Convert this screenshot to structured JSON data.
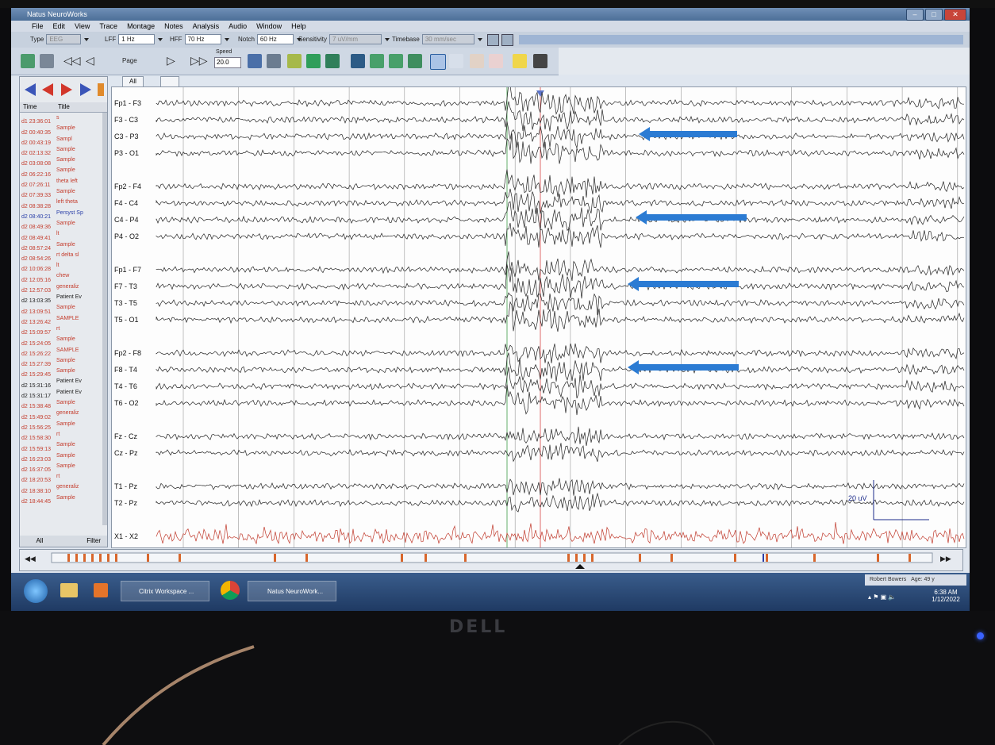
{
  "window": {
    "title": "Natus NeuroWorks"
  },
  "menu": [
    "File",
    "Edit",
    "View",
    "Trace",
    "Montage",
    "Notes",
    "Analysis",
    "Audio",
    "Window",
    "Help"
  ],
  "toolbar": {
    "type": {
      "label": "Type",
      "value": "EEG"
    },
    "lff": {
      "label": "LFF",
      "value": "1 Hz"
    },
    "hff": {
      "label": "HFF",
      "value": "70 Hz"
    },
    "notch": {
      "label": "Notch",
      "value": "60 Hz"
    },
    "sensitivity": {
      "label": "Sensitivity",
      "value": "7 uV/mm"
    },
    "timebase": {
      "label": "Timebase",
      "value": "30 mm/sec"
    },
    "page_label": "Page",
    "speed_label": "Speed",
    "speed_value": "20.0"
  },
  "sidebar": {
    "col_time": "Time",
    "col_title": "Title",
    "filter_label": "All",
    "filter_value": "Filter",
    "events": [
      {
        "time": "d1 23:36:01",
        "title": "s",
        "color": "#c43c2c"
      },
      {
        "time": "d2 00:40:35",
        "title": "Sample",
        "color": "#c43c2c"
      },
      {
        "time": "d2 00:43:19",
        "title": "Sampl",
        "color": "#c43c2c"
      },
      {
        "time": "d2 02:13:32",
        "title": "Sample",
        "color": "#c43c2c"
      },
      {
        "time": "d2 03:08:08",
        "title": "Sample",
        "color": "#c43c2c"
      },
      {
        "time": "d2 06:22:16",
        "title": "Sample",
        "color": "#c43c2c"
      },
      {
        "time": "d2 07:26:11",
        "title": "theta left",
        "color": "#c43c2c"
      },
      {
        "time": "d2 07:39:33",
        "title": "Sample",
        "color": "#c43c2c"
      },
      {
        "time": "d2 08:38:28",
        "title": "left theta",
        "color": "#c43c2c"
      },
      {
        "time": "d2 08:40:21",
        "title": "Persyst Sp",
        "color": "#2a3fa8"
      },
      {
        "time": "d2 08:49:36",
        "title": "Sample",
        "color": "#c43c2c"
      },
      {
        "time": "d2 08:49:41",
        "title": "lt",
        "color": "#c43c2c"
      },
      {
        "time": "d2 08:57:24",
        "title": "Sample",
        "color": "#c43c2c"
      },
      {
        "time": "d2 08:54:26",
        "title": "rt delta sl",
        "color": "#c43c2c"
      },
      {
        "time": "d2 10:06:28",
        "title": "lt",
        "color": "#c43c2c"
      },
      {
        "time": "d2 12:05:16",
        "title": "chew",
        "color": "#c43c2c"
      },
      {
        "time": "d2 12:57:03",
        "title": "generaliz",
        "color": "#c43c2c"
      },
      {
        "time": "d2 13:03:35",
        "title": "Patient Ev",
        "color": "#222222"
      },
      {
        "time": "d2 13:09:51",
        "title": "Sample",
        "color": "#c43c2c"
      },
      {
        "time": "d2 13:26:42",
        "title": "SAMPLE",
        "color": "#c43c2c"
      },
      {
        "time": "d2 15:09:57",
        "title": "rt",
        "color": "#c43c2c"
      },
      {
        "time": "d2 15:24:05",
        "title": "Sample",
        "color": "#c43c2c"
      },
      {
        "time": "d2 15:26:22",
        "title": "SAMPLE",
        "color": "#c43c2c"
      },
      {
        "time": "d2 15:27:39",
        "title": "Sample",
        "color": "#c43c2c"
      },
      {
        "time": "d2 15:29:45",
        "title": "Sample",
        "color": "#c43c2c"
      },
      {
        "time": "d2 15:31:16",
        "title": "Patient Ev",
        "color": "#222222"
      },
      {
        "time": "d2 15:31:17",
        "title": "Patient Ev",
        "color": "#222222"
      },
      {
        "time": "d2 15:38:48",
        "title": "Sample",
        "color": "#c43c2c"
      },
      {
        "time": "d2 15:49:02",
        "title": "generaliz",
        "color": "#c43c2c"
      },
      {
        "time": "d2 15:56:25",
        "title": "Sample",
        "color": "#c43c2c"
      },
      {
        "time": "d2 15:58:30",
        "title": "rt",
        "color": "#c43c2c"
      },
      {
        "time": "d2 15:59:13",
        "title": "Sample",
        "color": "#c43c2c"
      },
      {
        "time": "d2 16:23:03",
        "title": "Sample",
        "color": "#c43c2c"
      },
      {
        "time": "d2 16:37:05",
        "title": "Sample",
        "color": "#c43c2c"
      },
      {
        "time": "d2 18:20:53",
        "title": "rt",
        "color": "#c43c2c"
      },
      {
        "time": "d2 18:38:10",
        "title": "generaliz",
        "color": "#c43c2c"
      },
      {
        "time": "d2 18:44:45",
        "title": "Sample",
        "color": "#c43c2c"
      }
    ]
  },
  "tabs": [
    "All"
  ],
  "channels": [
    {
      "label": "Fp1 - F3",
      "group": 1
    },
    {
      "label": "F3 - C3",
      "group": 1
    },
    {
      "label": "C3 - P3",
      "group": 1
    },
    {
      "label": "P3 - O1",
      "group": 1
    },
    {
      "label": "Fp2 - F4",
      "group": 2
    },
    {
      "label": "F4 - C4",
      "group": 2
    },
    {
      "label": "C4 - P4",
      "group": 2
    },
    {
      "label": "P4 - O2",
      "group": 2
    },
    {
      "label": "Fp1 - F7",
      "group": 3
    },
    {
      "label": "F7 - T3",
      "group": 3
    },
    {
      "label": "T3 - T5",
      "group": 3
    },
    {
      "label": "T5 - O1",
      "group": 3
    },
    {
      "label": "Fp2 - F8",
      "group": 4
    },
    {
      "label": "F8 - T4",
      "group": 4
    },
    {
      "label": "T4 - T6",
      "group": 4
    },
    {
      "label": "T6 - O2",
      "group": 4
    },
    {
      "label": "Fz - Cz",
      "group": 5
    },
    {
      "label": "Cz - Pz",
      "group": 5
    },
    {
      "label": "T1 - Pz",
      "group": 6
    },
    {
      "label": "T2 - Pz",
      "group": 6
    },
    {
      "label": "X1 - X2",
      "group": 7,
      "color": "#c0392b"
    }
  ],
  "scale_label": "20 uV",
  "colors": {
    "trace": "#222222",
    "ekg": "#c0392b",
    "arrow": "#2b7bd3",
    "grid": "#999999",
    "cursor": "#e06a6a",
    "green_line": "#3c9b45"
  },
  "taskbar": {
    "items": [
      "Citrix Workspace ...",
      "Natus NeuroWork..."
    ],
    "patient": "Robert Bowers",
    "age": "Age: 49 y",
    "time": "6:38 AM",
    "date": "1/12/2022"
  },
  "monitor_brand": "DELL"
}
